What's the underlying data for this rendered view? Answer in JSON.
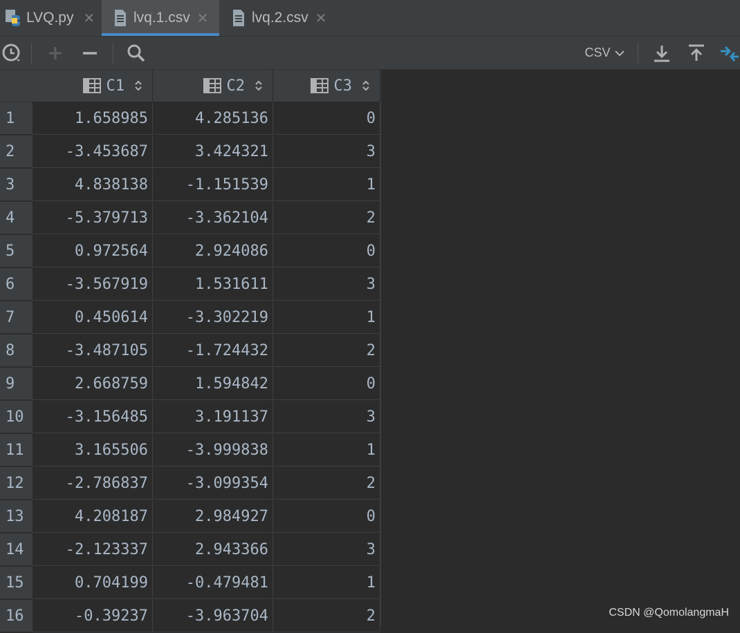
{
  "tabs": [
    {
      "label": "LVQ.py",
      "icon": "python-file-icon",
      "active": false
    },
    {
      "label": "lvq.1.csv",
      "icon": "text-file-icon",
      "active": true
    },
    {
      "label": "lvq.2.csv",
      "icon": "text-file-icon",
      "active": false
    }
  ],
  "toolbar": {
    "format_label": "CSV",
    "accent_color": "#4a88c7"
  },
  "table": {
    "columns": [
      "C1",
      "C2",
      "C3"
    ],
    "rows": [
      {
        "n": "1",
        "c1": "1.658985",
        "c2": "4.285136",
        "c3": "0"
      },
      {
        "n": "2",
        "c1": "-3.453687",
        "c2": "3.424321",
        "c3": "3"
      },
      {
        "n": "3",
        "c1": "4.838138",
        "c2": "-1.151539",
        "c3": "1"
      },
      {
        "n": "4",
        "c1": "-5.379713",
        "c2": "-3.362104",
        "c3": "2"
      },
      {
        "n": "5",
        "c1": "0.972564",
        "c2": "2.924086",
        "c3": "0"
      },
      {
        "n": "6",
        "c1": "-3.567919",
        "c2": "1.531611",
        "c3": "3"
      },
      {
        "n": "7",
        "c1": "0.450614",
        "c2": "-3.302219",
        "c3": "1"
      },
      {
        "n": "8",
        "c1": "-3.487105",
        "c2": "-1.724432",
        "c3": "2"
      },
      {
        "n": "9",
        "c1": "2.668759",
        "c2": "1.594842",
        "c3": "0"
      },
      {
        "n": "10",
        "c1": "-3.156485",
        "c2": "3.191137",
        "c3": "3"
      },
      {
        "n": "11",
        "c1": "3.165506",
        "c2": "-3.999838",
        "c3": "1"
      },
      {
        "n": "12",
        "c1": "-2.786837",
        "c2": "-3.099354",
        "c3": "2"
      },
      {
        "n": "13",
        "c1": "4.208187",
        "c2": "2.984927",
        "c3": "0"
      },
      {
        "n": "14",
        "c1": "-2.123337",
        "c2": "2.943366",
        "c3": "3"
      },
      {
        "n": "15",
        "c1": "0.704199",
        "c2": "-0.479481",
        "c3": "1"
      },
      {
        "n": "16",
        "c1": "-0.39237",
        "c2": "-3.963704",
        "c3": "2"
      }
    ]
  },
  "watermark": "CSDN @QomolangmaH"
}
